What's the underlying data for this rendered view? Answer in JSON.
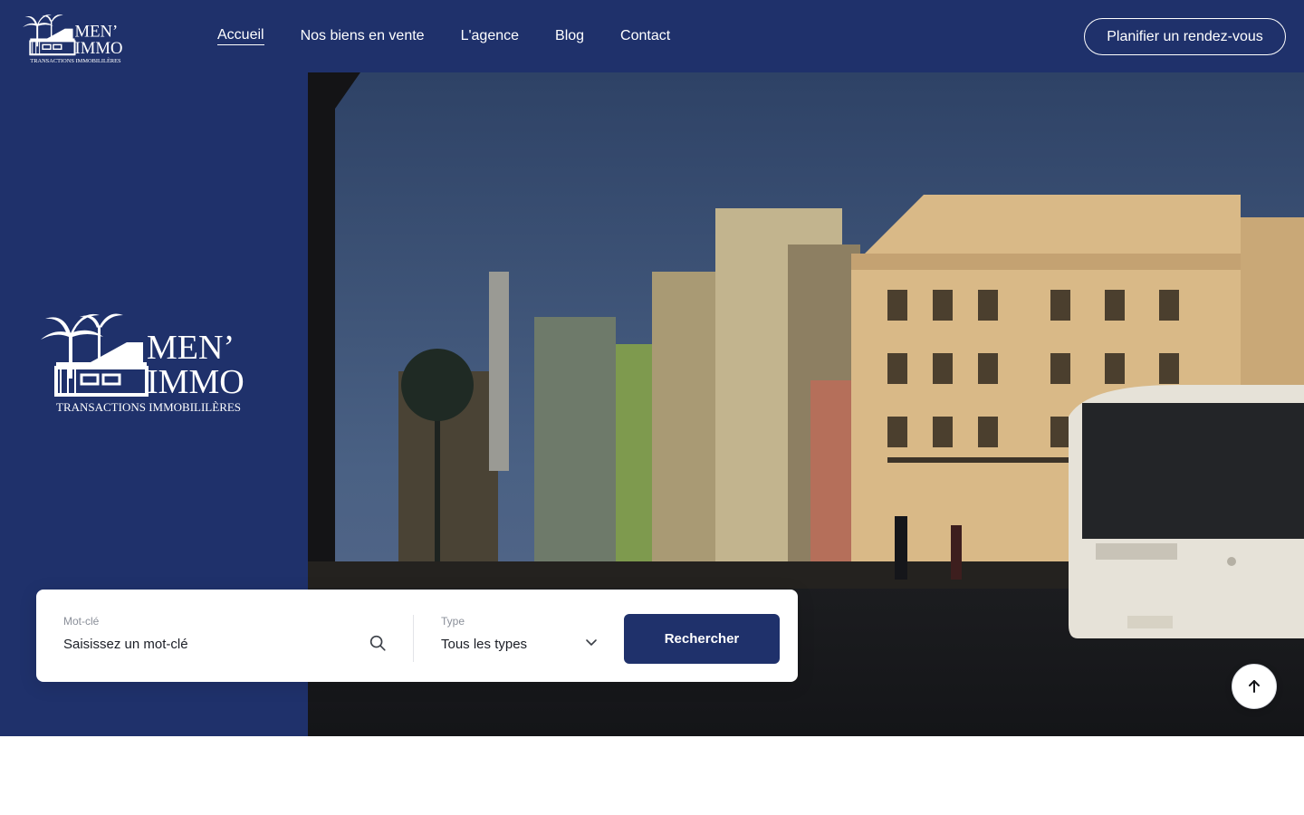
{
  "brand": {
    "name_line1": "MEN’",
    "name_line2": "IMMO",
    "tagline": "TRANSACTIONS IMMOBILILÈRES",
    "primary_color": "#1f316b"
  },
  "nav": {
    "items": [
      {
        "label": "Accueil",
        "active": true
      },
      {
        "label": "Nos biens en vente",
        "active": false
      },
      {
        "label": "L'agence",
        "active": false
      },
      {
        "label": "Blog",
        "active": false
      },
      {
        "label": "Contact",
        "active": false
      }
    ]
  },
  "header": {
    "cta_label": "Planifier un rendez-vous"
  },
  "search": {
    "keyword_label": "Mot-clé",
    "keyword_placeholder": "Saisissez un mot-clé",
    "type_label": "Type",
    "type_value": "Tous les types",
    "button_label": "Recherche­r",
    "search_icon": "search-icon",
    "dropdown_icon": "chevron-down-icon"
  },
  "hero": {
    "image_subject": "street-buildings-bus-photo"
  },
  "scroll_top": {
    "icon": "arrow-up-icon"
  }
}
